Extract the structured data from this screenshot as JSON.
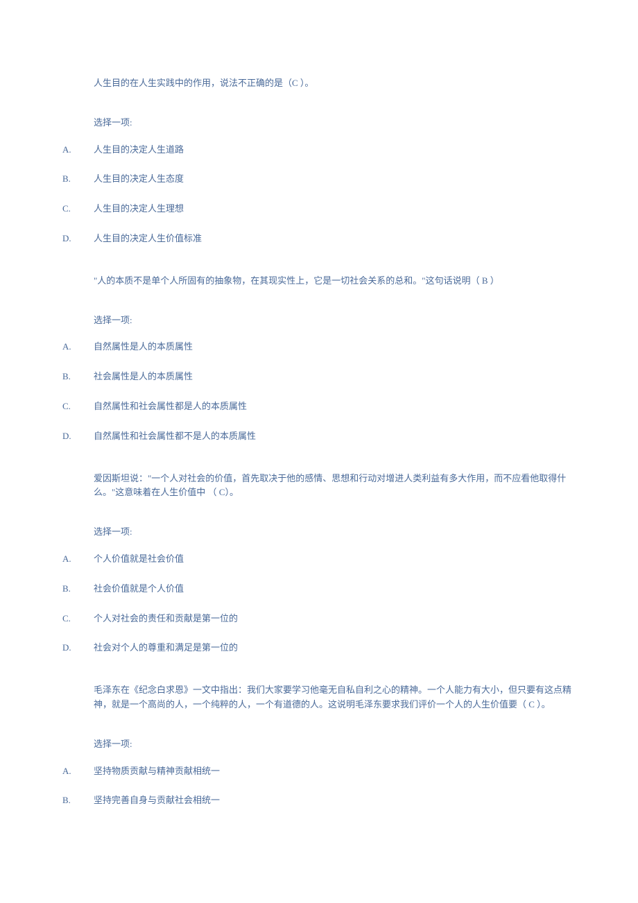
{
  "questions": [
    {
      "text": "人生目的在人生实践中的作用，说法不正确的是（C ）。",
      "prompt": "选择一项:",
      "options": [
        {
          "letter": "A.",
          "text": "人生目的决定人生道路"
        },
        {
          "letter": "B.",
          "text": "人生目的决定人生态度"
        },
        {
          "letter": "C.",
          "text": "人生目的决定人生理想"
        },
        {
          "letter": "D.",
          "text": "人生目的决定人生价值标准"
        }
      ]
    },
    {
      "text": "\"人的本质不是单个人所固有的抽象物，在其现实性上，它是一切社会关系的总和。\"这句话说明（  B ）",
      "prompt": "选择一项:",
      "options": [
        {
          "letter": "A.",
          "text": "自然属性是人的本质属性"
        },
        {
          "letter": "B.",
          "text": "社会属性是人的本质属性"
        },
        {
          "letter": "C.",
          "text": "自然属性和社会属性都是人的本质属性"
        },
        {
          "letter": "D.",
          "text": "自然属性和社会属性都不是人的本质属性"
        }
      ]
    },
    {
      "text": "爱因斯坦说：\"一个人对社会的价值，首先取决于他的感情、思想和行动对增进人类利益有多大作用，而不应看他取得什么。\"这意味着在人生价值中 （ C）。",
      "prompt": "选择一项:",
      "options": [
        {
          "letter": "A.",
          "text": "个人价值就是社会价值"
        },
        {
          "letter": "B.",
          "text": "社会价值就是个人价值"
        },
        {
          "letter": "C.",
          "text": "个人对社会的责任和贡献是第一位的"
        },
        {
          "letter": "D.",
          "text": "社会对个人的尊重和满足是第一位的"
        }
      ]
    },
    {
      "text": "毛泽东在《纪念白求恩》一文中指出：我们大家要学习他毫无自私自利之心的精神。一个人能力有大小，但只要有这点精神，就是一个高尚的人，一个纯粹的人，一个有道德的人。这说明毛泽东要求我们评价一个人的人生价值要（  C  ）。",
      "prompt": "选择一项:",
      "options": [
        {
          "letter": "A.",
          "text": "坚持物质贡献与精神贡献相统一"
        },
        {
          "letter": "B.",
          "text": "坚持完善自身与贡献社会相统一"
        }
      ]
    }
  ]
}
